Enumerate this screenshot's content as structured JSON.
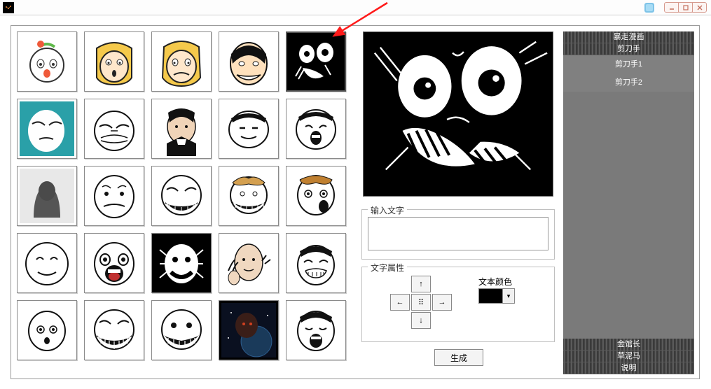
{
  "window": {
    "title": ""
  },
  "thumbs": [
    {
      "name": "face-1"
    },
    {
      "name": "face-2"
    },
    {
      "name": "face-3"
    },
    {
      "name": "face-4"
    },
    {
      "name": "face-5-selected"
    },
    {
      "name": "face-6"
    },
    {
      "name": "face-7"
    },
    {
      "name": "face-8"
    },
    {
      "name": "face-9"
    },
    {
      "name": "face-10"
    },
    {
      "name": "face-11"
    },
    {
      "name": "face-12"
    },
    {
      "name": "face-13"
    },
    {
      "name": "face-14"
    },
    {
      "name": "face-15"
    },
    {
      "name": "face-16"
    },
    {
      "name": "face-17"
    },
    {
      "name": "face-18"
    },
    {
      "name": "face-19"
    },
    {
      "name": "face-20"
    },
    {
      "name": "face-21"
    },
    {
      "name": "face-22"
    },
    {
      "name": "face-23"
    },
    {
      "name": "face-24"
    },
    {
      "name": "face-25"
    }
  ],
  "input": {
    "legend": "输入文字",
    "value": ""
  },
  "attr": {
    "legend": "文字属性",
    "up": "↑",
    "down": "↓",
    "left": "←",
    "right": "→",
    "center": "⠿",
    "color_label": "文本颜色",
    "dropdown": "▾"
  },
  "generate_label": "生成",
  "sidebar": {
    "header": [
      "暴走漫画",
      "剪刀手"
    ],
    "mid": [
      "剪刀手1",
      "剪刀手2"
    ],
    "footer": [
      "金馆长",
      "草泥马",
      "说明"
    ]
  },
  "colors": {
    "text_color": "#000000"
  }
}
